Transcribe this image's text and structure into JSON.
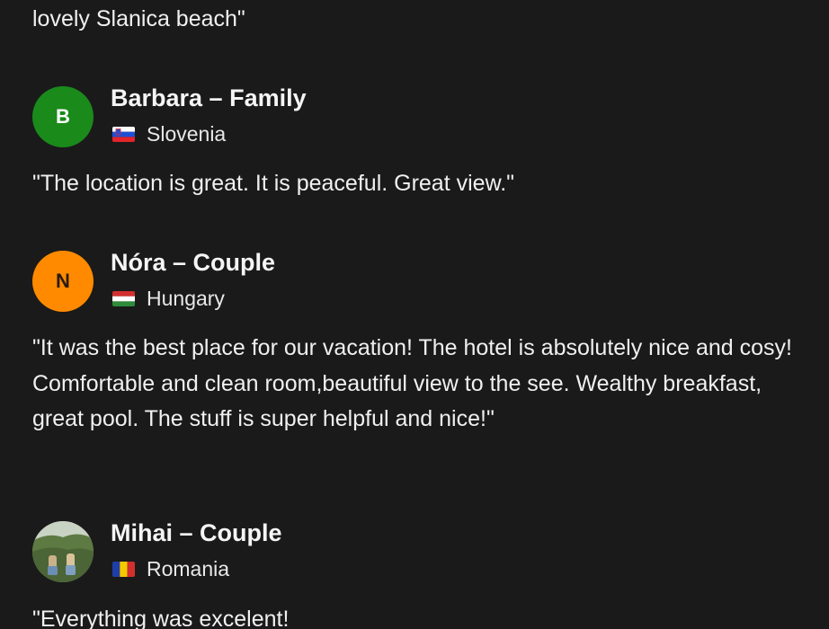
{
  "reviews": [
    {
      "text": "lovely Slanica beach\""
    },
    {
      "reviewer": {
        "initial": "B",
        "name": "Barbara – Family",
        "country": "Slovenia",
        "flag_icon": "slovenia-flag-icon",
        "avatar_color": "#1a8a1a"
      },
      "text": "\"The location is great. It is peaceful. Great view.\""
    },
    {
      "reviewer": {
        "initial": "N",
        "name": "Nóra – Couple",
        "country": "Hungary",
        "flag_icon": "hungary-flag-icon",
        "avatar_color": "#ff8a00"
      },
      "text": "\"It was the best place for our vacation! The hotel is absolutely nice and cosy! Comfortable and clean room,beautiful view to the see. Wealthy breakfast, great pool. The stuff is super helpful and nice!\""
    },
    {
      "reviewer": {
        "name": "Mihai – Couple",
        "country": "Romania",
        "flag_icon": "romania-flag-icon",
        "avatar_icon": "user-photo-avatar"
      },
      "text": "\"Everything was excelent!"
    }
  ]
}
